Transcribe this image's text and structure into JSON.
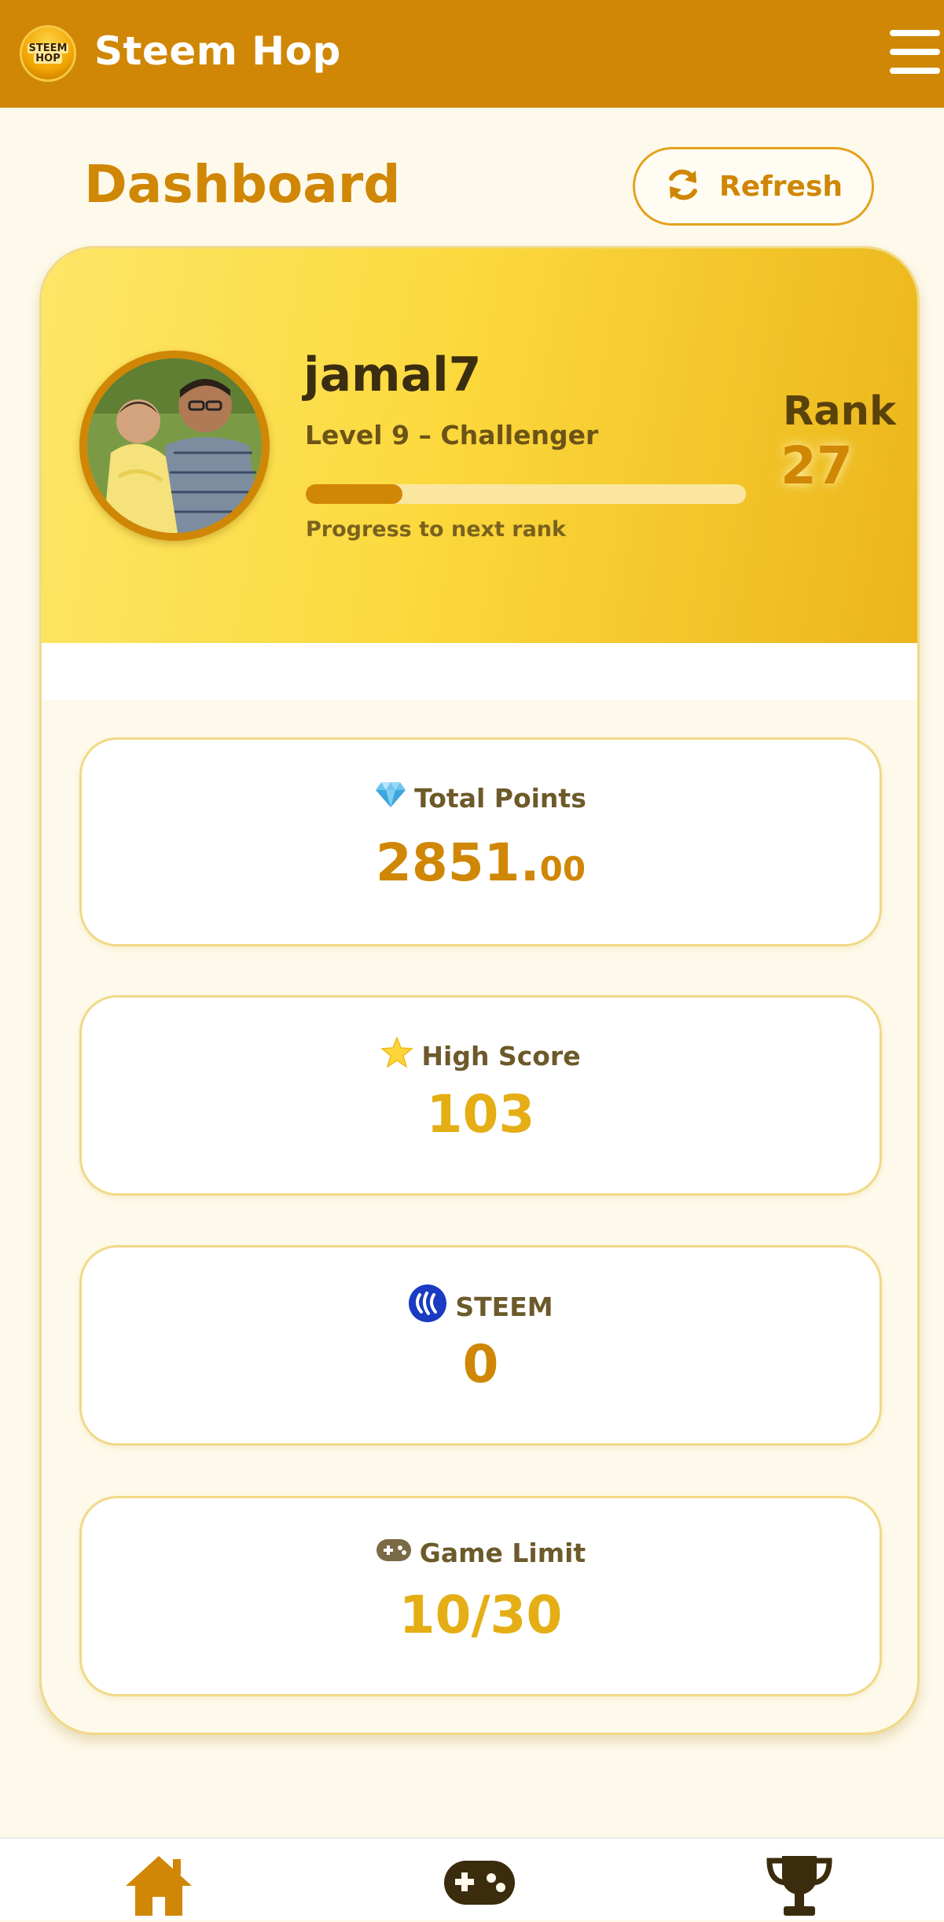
{
  "header": {
    "app_title": "Steem Hop",
    "logo_text_1": "STEEM",
    "logo_text_2": "HOP",
    "menu_icon": "hamburger-menu-icon"
  },
  "page": {
    "title": "Dashboard",
    "refresh_label": "Refresh",
    "refresh_icon": "sync-icon"
  },
  "profile": {
    "username": "jamal7",
    "level_text": "Level 9 – Challenger",
    "progress_fraction": 0.22,
    "progress_label": "Progress to next rank",
    "rank_label": "Rank",
    "rank_value": "27"
  },
  "stats": [
    {
      "icon": "gem-icon",
      "label": "Total Points",
      "value_int": "2851.",
      "value_dec": "00"
    },
    {
      "icon": "star-icon",
      "label": "High Score",
      "value": "103"
    },
    {
      "icon": "steem-logo-icon",
      "label": "STEEM",
      "value": "0"
    },
    {
      "icon": "gamepad-icon",
      "label": "Game Limit",
      "value": "10/30"
    }
  ],
  "nav": [
    {
      "icon": "home-icon"
    },
    {
      "icon": "gamepad-icon"
    },
    {
      "icon": "trophy-icon"
    }
  ],
  "colors": {
    "primary": "#d08705",
    "header_bg": "#d08705",
    "accent_gold": "#e4ae14",
    "background": "#fefaeb",
    "text_dark": "#3b2d10"
  }
}
